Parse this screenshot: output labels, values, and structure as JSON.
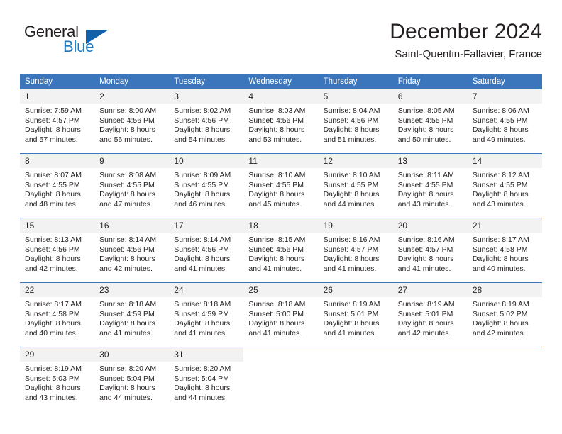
{
  "brand": {
    "name_part1": "General",
    "name_part2": "Blue",
    "flag_icon": "triangle-flag-icon",
    "accent_color": "#1b7ac4",
    "flag_color": "#1260a8"
  },
  "header": {
    "title": "December 2024",
    "subtitle": "Saint-Quentin-Fallavier, France"
  },
  "calendar": {
    "header_bg_color": "#3b76bd",
    "daynum_bg_color": "#f2f2f2",
    "weekday_headers": [
      "Sunday",
      "Monday",
      "Tuesday",
      "Wednesday",
      "Thursday",
      "Friday",
      "Saturday"
    ],
    "weeks": [
      [
        {
          "day": "1",
          "sunrise": "Sunrise: 7:59 AM",
          "sunset": "Sunset: 4:57 PM",
          "daylight_line1": "Daylight: 8 hours",
          "daylight_line2": "and 57 minutes."
        },
        {
          "day": "2",
          "sunrise": "Sunrise: 8:00 AM",
          "sunset": "Sunset: 4:56 PM",
          "daylight_line1": "Daylight: 8 hours",
          "daylight_line2": "and 56 minutes."
        },
        {
          "day": "3",
          "sunrise": "Sunrise: 8:02 AM",
          "sunset": "Sunset: 4:56 PM",
          "daylight_line1": "Daylight: 8 hours",
          "daylight_line2": "and 54 minutes."
        },
        {
          "day": "4",
          "sunrise": "Sunrise: 8:03 AM",
          "sunset": "Sunset: 4:56 PM",
          "daylight_line1": "Daylight: 8 hours",
          "daylight_line2": "and 53 minutes."
        },
        {
          "day": "5",
          "sunrise": "Sunrise: 8:04 AM",
          "sunset": "Sunset: 4:56 PM",
          "daylight_line1": "Daylight: 8 hours",
          "daylight_line2": "and 51 minutes."
        },
        {
          "day": "6",
          "sunrise": "Sunrise: 8:05 AM",
          "sunset": "Sunset: 4:55 PM",
          "daylight_line1": "Daylight: 8 hours",
          "daylight_line2": "and 50 minutes."
        },
        {
          "day": "7",
          "sunrise": "Sunrise: 8:06 AM",
          "sunset": "Sunset: 4:55 PM",
          "daylight_line1": "Daylight: 8 hours",
          "daylight_line2": "and 49 minutes."
        }
      ],
      [
        {
          "day": "8",
          "sunrise": "Sunrise: 8:07 AM",
          "sunset": "Sunset: 4:55 PM",
          "daylight_line1": "Daylight: 8 hours",
          "daylight_line2": "and 48 minutes."
        },
        {
          "day": "9",
          "sunrise": "Sunrise: 8:08 AM",
          "sunset": "Sunset: 4:55 PM",
          "daylight_line1": "Daylight: 8 hours",
          "daylight_line2": "and 47 minutes."
        },
        {
          "day": "10",
          "sunrise": "Sunrise: 8:09 AM",
          "sunset": "Sunset: 4:55 PM",
          "daylight_line1": "Daylight: 8 hours",
          "daylight_line2": "and 46 minutes."
        },
        {
          "day": "11",
          "sunrise": "Sunrise: 8:10 AM",
          "sunset": "Sunset: 4:55 PM",
          "daylight_line1": "Daylight: 8 hours",
          "daylight_line2": "and 45 minutes."
        },
        {
          "day": "12",
          "sunrise": "Sunrise: 8:10 AM",
          "sunset": "Sunset: 4:55 PM",
          "daylight_line1": "Daylight: 8 hours",
          "daylight_line2": "and 44 minutes."
        },
        {
          "day": "13",
          "sunrise": "Sunrise: 8:11 AM",
          "sunset": "Sunset: 4:55 PM",
          "daylight_line1": "Daylight: 8 hours",
          "daylight_line2": "and 43 minutes."
        },
        {
          "day": "14",
          "sunrise": "Sunrise: 8:12 AM",
          "sunset": "Sunset: 4:55 PM",
          "daylight_line1": "Daylight: 8 hours",
          "daylight_line2": "and 43 minutes."
        }
      ],
      [
        {
          "day": "15",
          "sunrise": "Sunrise: 8:13 AM",
          "sunset": "Sunset: 4:56 PM",
          "daylight_line1": "Daylight: 8 hours",
          "daylight_line2": "and 42 minutes."
        },
        {
          "day": "16",
          "sunrise": "Sunrise: 8:14 AM",
          "sunset": "Sunset: 4:56 PM",
          "daylight_line1": "Daylight: 8 hours",
          "daylight_line2": "and 42 minutes."
        },
        {
          "day": "17",
          "sunrise": "Sunrise: 8:14 AM",
          "sunset": "Sunset: 4:56 PM",
          "daylight_line1": "Daylight: 8 hours",
          "daylight_line2": "and 41 minutes."
        },
        {
          "day": "18",
          "sunrise": "Sunrise: 8:15 AM",
          "sunset": "Sunset: 4:56 PM",
          "daylight_line1": "Daylight: 8 hours",
          "daylight_line2": "and 41 minutes."
        },
        {
          "day": "19",
          "sunrise": "Sunrise: 8:16 AM",
          "sunset": "Sunset: 4:57 PM",
          "daylight_line1": "Daylight: 8 hours",
          "daylight_line2": "and 41 minutes."
        },
        {
          "day": "20",
          "sunrise": "Sunrise: 8:16 AM",
          "sunset": "Sunset: 4:57 PM",
          "daylight_line1": "Daylight: 8 hours",
          "daylight_line2": "and 41 minutes."
        },
        {
          "day": "21",
          "sunrise": "Sunrise: 8:17 AM",
          "sunset": "Sunset: 4:58 PM",
          "daylight_line1": "Daylight: 8 hours",
          "daylight_line2": "and 40 minutes."
        }
      ],
      [
        {
          "day": "22",
          "sunrise": "Sunrise: 8:17 AM",
          "sunset": "Sunset: 4:58 PM",
          "daylight_line1": "Daylight: 8 hours",
          "daylight_line2": "and 40 minutes."
        },
        {
          "day": "23",
          "sunrise": "Sunrise: 8:18 AM",
          "sunset": "Sunset: 4:59 PM",
          "daylight_line1": "Daylight: 8 hours",
          "daylight_line2": "and 41 minutes."
        },
        {
          "day": "24",
          "sunrise": "Sunrise: 8:18 AM",
          "sunset": "Sunset: 4:59 PM",
          "daylight_line1": "Daylight: 8 hours",
          "daylight_line2": "and 41 minutes."
        },
        {
          "day": "25",
          "sunrise": "Sunrise: 8:18 AM",
          "sunset": "Sunset: 5:00 PM",
          "daylight_line1": "Daylight: 8 hours",
          "daylight_line2": "and 41 minutes."
        },
        {
          "day": "26",
          "sunrise": "Sunrise: 8:19 AM",
          "sunset": "Sunset: 5:01 PM",
          "daylight_line1": "Daylight: 8 hours",
          "daylight_line2": "and 41 minutes."
        },
        {
          "day": "27",
          "sunrise": "Sunrise: 8:19 AM",
          "sunset": "Sunset: 5:01 PM",
          "daylight_line1": "Daylight: 8 hours",
          "daylight_line2": "and 42 minutes."
        },
        {
          "day": "28",
          "sunrise": "Sunrise: 8:19 AM",
          "sunset": "Sunset: 5:02 PM",
          "daylight_line1": "Daylight: 8 hours",
          "daylight_line2": "and 42 minutes."
        }
      ],
      [
        {
          "day": "29",
          "sunrise": "Sunrise: 8:19 AM",
          "sunset": "Sunset: 5:03 PM",
          "daylight_line1": "Daylight: 8 hours",
          "daylight_line2": "and 43 minutes."
        },
        {
          "day": "30",
          "sunrise": "Sunrise: 8:20 AM",
          "sunset": "Sunset: 5:04 PM",
          "daylight_line1": "Daylight: 8 hours",
          "daylight_line2": "and 44 minutes."
        },
        {
          "day": "31",
          "sunrise": "Sunrise: 8:20 AM",
          "sunset": "Sunset: 5:04 PM",
          "daylight_line1": "Daylight: 8 hours",
          "daylight_line2": "and 44 minutes."
        },
        null,
        null,
        null,
        null
      ]
    ]
  }
}
